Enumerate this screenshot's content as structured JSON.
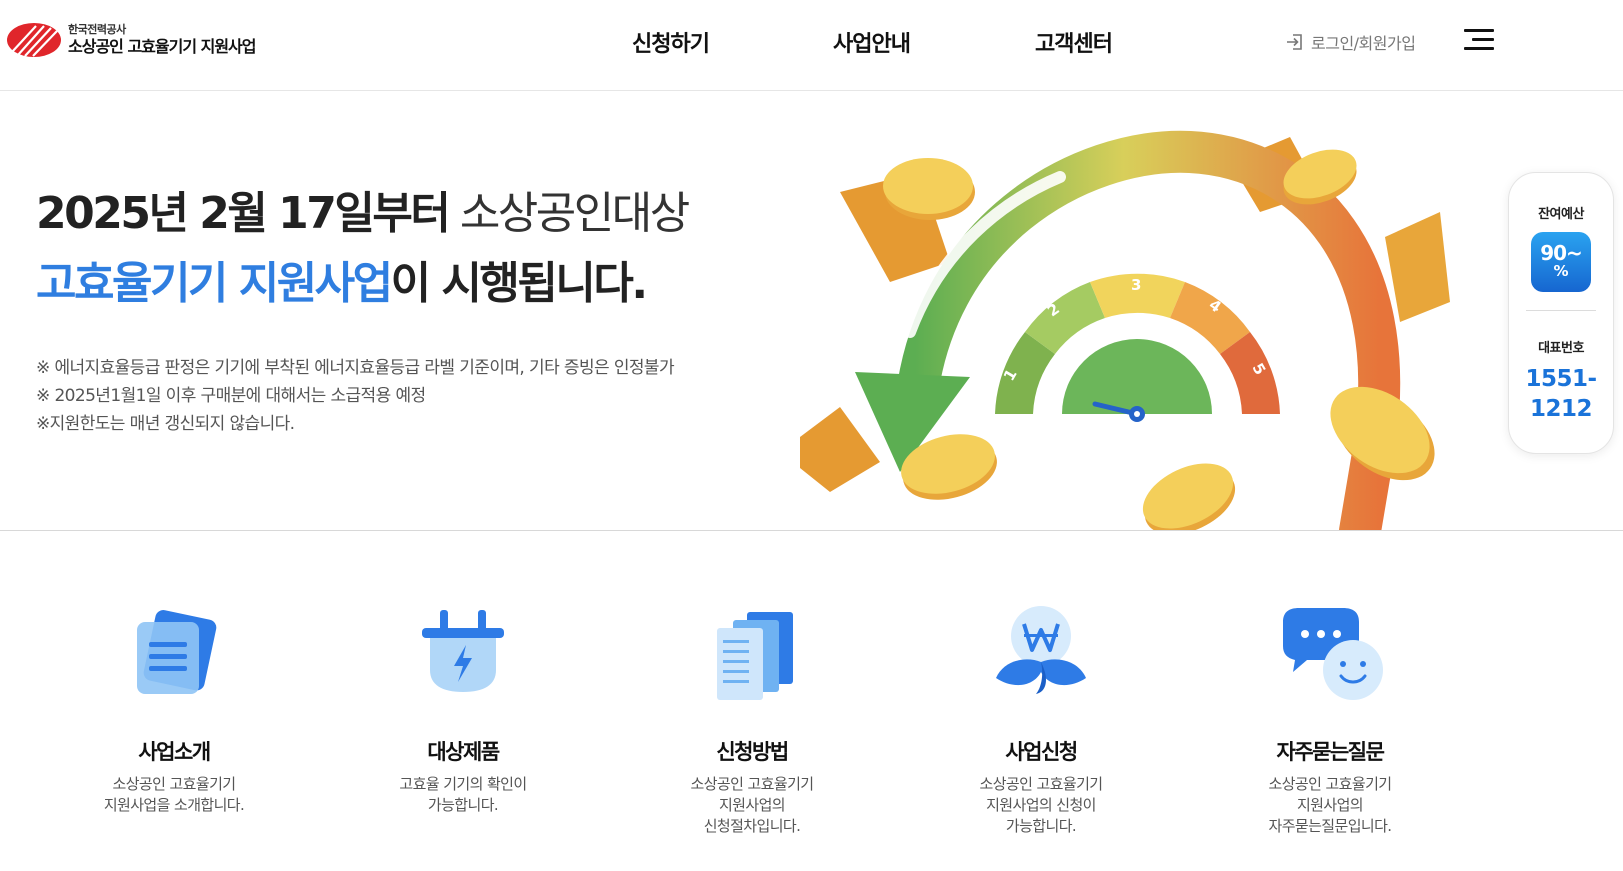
{
  "header": {
    "logo_org": "한국전력공사",
    "logo_title": "소상공인 고효율기기 지원사업",
    "nav": [
      "신청하기",
      "사업안내",
      "고객센터"
    ],
    "login_label": "로그인/회원가입"
  },
  "hero": {
    "line1_bold": "2025년 2월 17일부터",
    "line1_light": " 소상공인대상",
    "line2_accent": "고효율기기 지원사업",
    "line2_rest": "이 시행됩니다.",
    "notes": [
      "※ 에너지효율등급 판정은 기기에 부착된 에너지효율등급 라벨 기준이며, 기타 증빙은 인정불가",
      "※ 2025년1월1일 이후 구매분에 대해서는 소급적용 예정",
      "※지원한도는 매년 갱신되지 않습니다."
    ],
    "gauge_labels": [
      "1",
      "2",
      "3",
      "4",
      "5"
    ]
  },
  "side_widget": {
    "budget_label": "잔여예산",
    "budget_value_top": "90~",
    "budget_value_bottom": "%",
    "phone_label": "대표번호",
    "phone_top": "1551-",
    "phone_bottom": "1212"
  },
  "cards": [
    {
      "title": "사업소개",
      "desc": "소상공인 고효율기기\n지원사업을 소개합니다.",
      "icon": "document-icon"
    },
    {
      "title": "대상제품",
      "desc": "고효율 기기의 확인이\n가능합니다.",
      "icon": "plug-icon"
    },
    {
      "title": "신청방법",
      "desc": "소상공인 고효율기기\n지원사업의\n신청절차입니다.",
      "icon": "files-icon"
    },
    {
      "title": "사업신청",
      "desc": "소상공인 고효율기기\n지원사업의 신청이\n가능합니다.",
      "icon": "won-plant-icon"
    },
    {
      "title": "자주묻는질문",
      "desc": "소상공인 고효율기기\n지원사업의\n자주묻는질문입니다.",
      "icon": "chat-faq-icon"
    }
  ],
  "colors": {
    "accent": "#2f7ee0",
    "phone": "#1a73d9",
    "logo_red": "#e0262b"
  }
}
